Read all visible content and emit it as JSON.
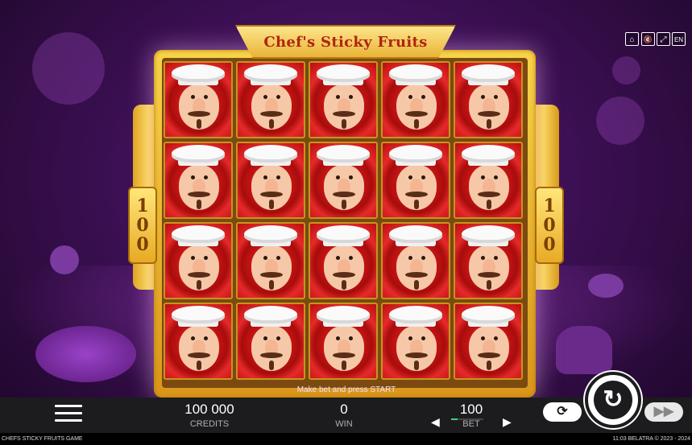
{
  "title": "Chef's Sticky Fruits",
  "side_multiplier_left": [
    "1",
    "0",
    "0"
  ],
  "side_multiplier_right": [
    "1",
    "0",
    "0"
  ],
  "top_buttons": [
    {
      "name": "home-icon",
      "glyph": "⌂"
    },
    {
      "name": "sound-icon",
      "glyph": "🔇"
    },
    {
      "name": "fullscreen-icon",
      "glyph": "⤢"
    },
    {
      "name": "language-button",
      "glyph": "EN"
    }
  ],
  "reels": {
    "rows": 4,
    "cols": 5,
    "symbol": "chef"
  },
  "hint": "Make bet and press START",
  "credits": {
    "value": "100 000",
    "label": "CREDITS"
  },
  "win": {
    "value": "0",
    "label": "WIN"
  },
  "bet": {
    "value": "100",
    "label": "BET"
  },
  "footer": {
    "left": "CHEFS STICKY FRUITS GAME",
    "right": "11:03  BELATRA © 2023 - 2024"
  }
}
